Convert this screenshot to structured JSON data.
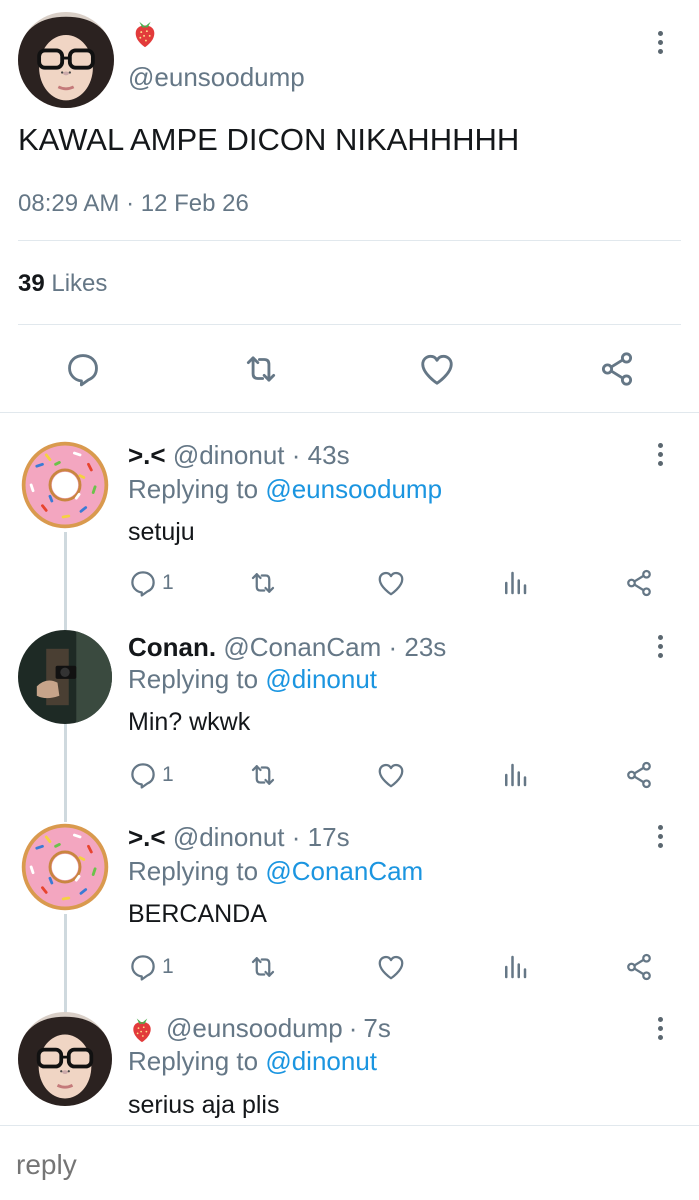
{
  "tweet": {
    "emoji": "🍓",
    "handle": "@eunsoodump",
    "text": "KAWAL AMPE DICON NIKAHHHHH",
    "time": "08:29 AM",
    "sep": "·",
    "date": "12 Feb 26",
    "likes_count": "39",
    "likes_label": "Likes"
  },
  "replies": [
    {
      "display_name": ">.<",
      "handle": "@dinonut",
      "sep": "·",
      "time": "43s",
      "replying_prefix": "Replying to",
      "replying_to": "@eunsoodump",
      "text": "setuju",
      "reply_count": "1"
    },
    {
      "display_name": "Conan.",
      "handle": "@ConanCam",
      "sep": "·",
      "time": "23s",
      "replying_prefix": "Replying to",
      "replying_to": "@dinonut",
      "text": "Min? wkwk",
      "reply_count": "1"
    },
    {
      "display_name": ">.<",
      "handle": "@dinonut",
      "sep": "·",
      "time": "17s",
      "replying_prefix": "Replying to",
      "replying_to": "@ConanCam",
      "text": "BERCANDA",
      "reply_count": "1"
    },
    {
      "emoji": "🍓",
      "handle": "@eunsoodump",
      "sep": "·",
      "time": "7s",
      "replying_prefix": "Replying to",
      "replying_to": "@dinonut",
      "text": "serius aja plis"
    }
  ],
  "composer": {
    "placeholder": "reply"
  },
  "colors": {
    "link": "#1b95e0",
    "muted": "#657786",
    "divider": "#e1e8ed"
  }
}
